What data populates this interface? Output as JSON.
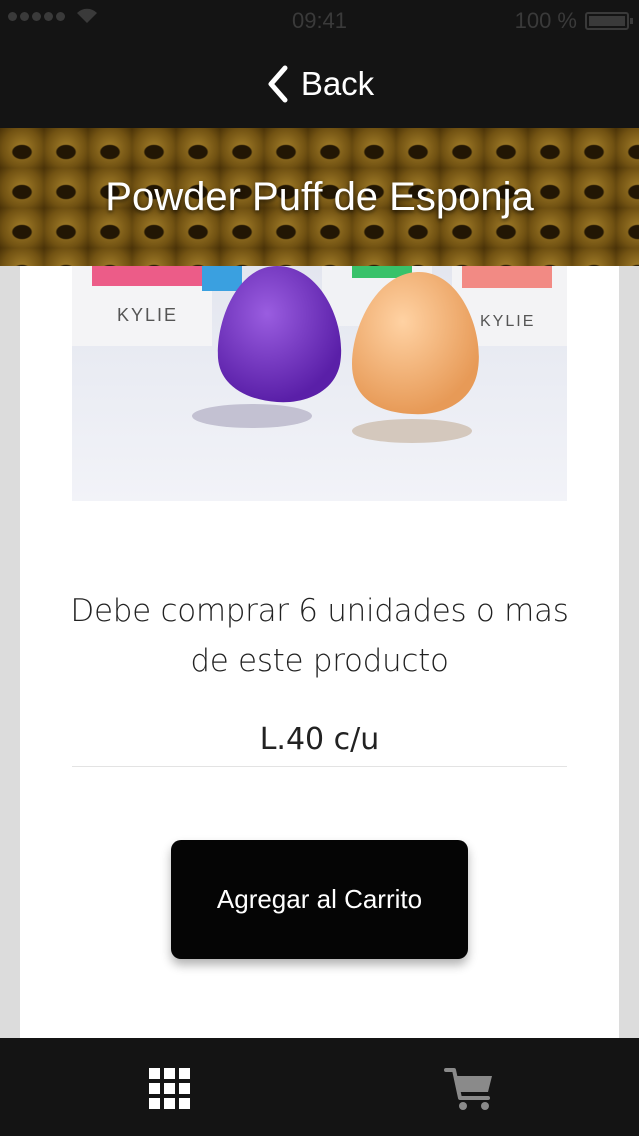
{
  "status_bar": {
    "time": "09:41",
    "battery_text": "100 %"
  },
  "nav": {
    "back_label": "Back"
  },
  "page": {
    "title": "Powder Puff de Esponja"
  },
  "product": {
    "brand_label": "KYLIE",
    "notice": "Debe comprar 6 unidades o mas de este producto",
    "price": "L.40 c/u",
    "add_to_cart_label": "Agregar al Carrito"
  },
  "tab_bar": {
    "items": [
      "grid-icon",
      "cart-icon"
    ]
  },
  "colors": {
    "bar_background": "#141414",
    "banner_gold": "#b8892a",
    "button_black": "#050505"
  }
}
